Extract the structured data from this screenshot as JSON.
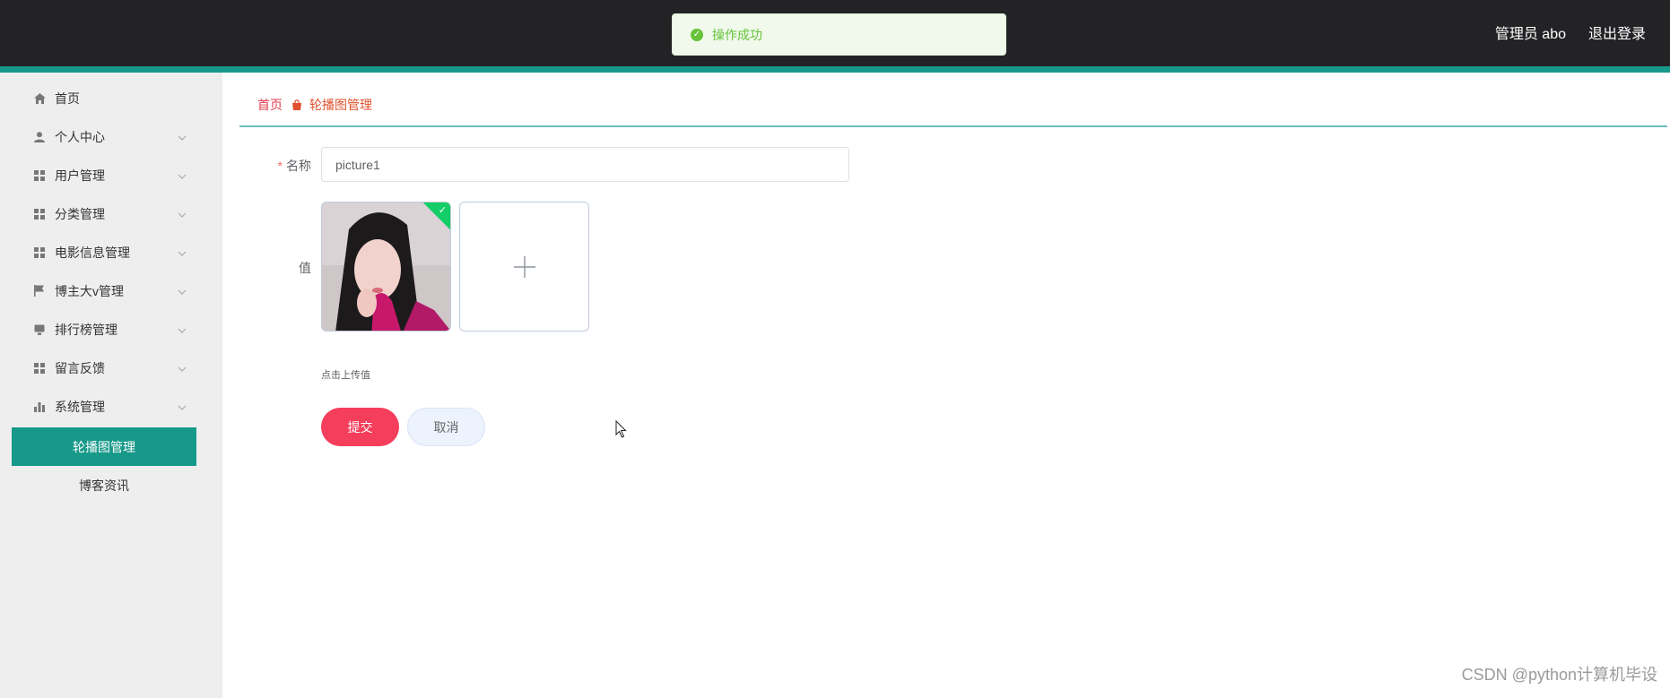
{
  "header": {
    "user_label": "管理员 abo",
    "logout_label": "退出登录"
  },
  "toast": {
    "message": "操作成功",
    "icon": "check-circle-icon",
    "color": "#67c23a"
  },
  "sidebar": {
    "items": [
      {
        "label": "首页",
        "icon": "home-icon"
      },
      {
        "label": "个人中心",
        "icon": "user-icon"
      },
      {
        "label": "用户管理",
        "icon": "grid-icon"
      },
      {
        "label": "分类管理",
        "icon": "grid-icon"
      },
      {
        "label": "电影信息管理",
        "icon": "grid-icon"
      },
      {
        "label": "博主大v管理",
        "icon": "flag-icon"
      },
      {
        "label": "排行榜管理",
        "icon": "monitor-icon"
      },
      {
        "label": "留言反馈",
        "icon": "grid-icon"
      },
      {
        "label": "系统管理",
        "icon": "bar-chart-icon"
      }
    ],
    "sub_items": [
      {
        "label": "轮播图管理",
        "active": true
      },
      {
        "label": "博客资讯",
        "active": false
      }
    ],
    "active_color": "#17998a"
  },
  "breadcrumb": {
    "home": "首页",
    "current": "轮播图管理"
  },
  "form": {
    "name_label": "名称",
    "name_value": "picture1",
    "value_label": "值",
    "upload_hint": "点击上传值",
    "submit_label": "提交",
    "cancel_label": "取消"
  },
  "watermark": "CSDN @python计算机毕设",
  "colors": {
    "topbar": "#232225",
    "accent": "#17998a",
    "submit": "#f43e5b"
  }
}
